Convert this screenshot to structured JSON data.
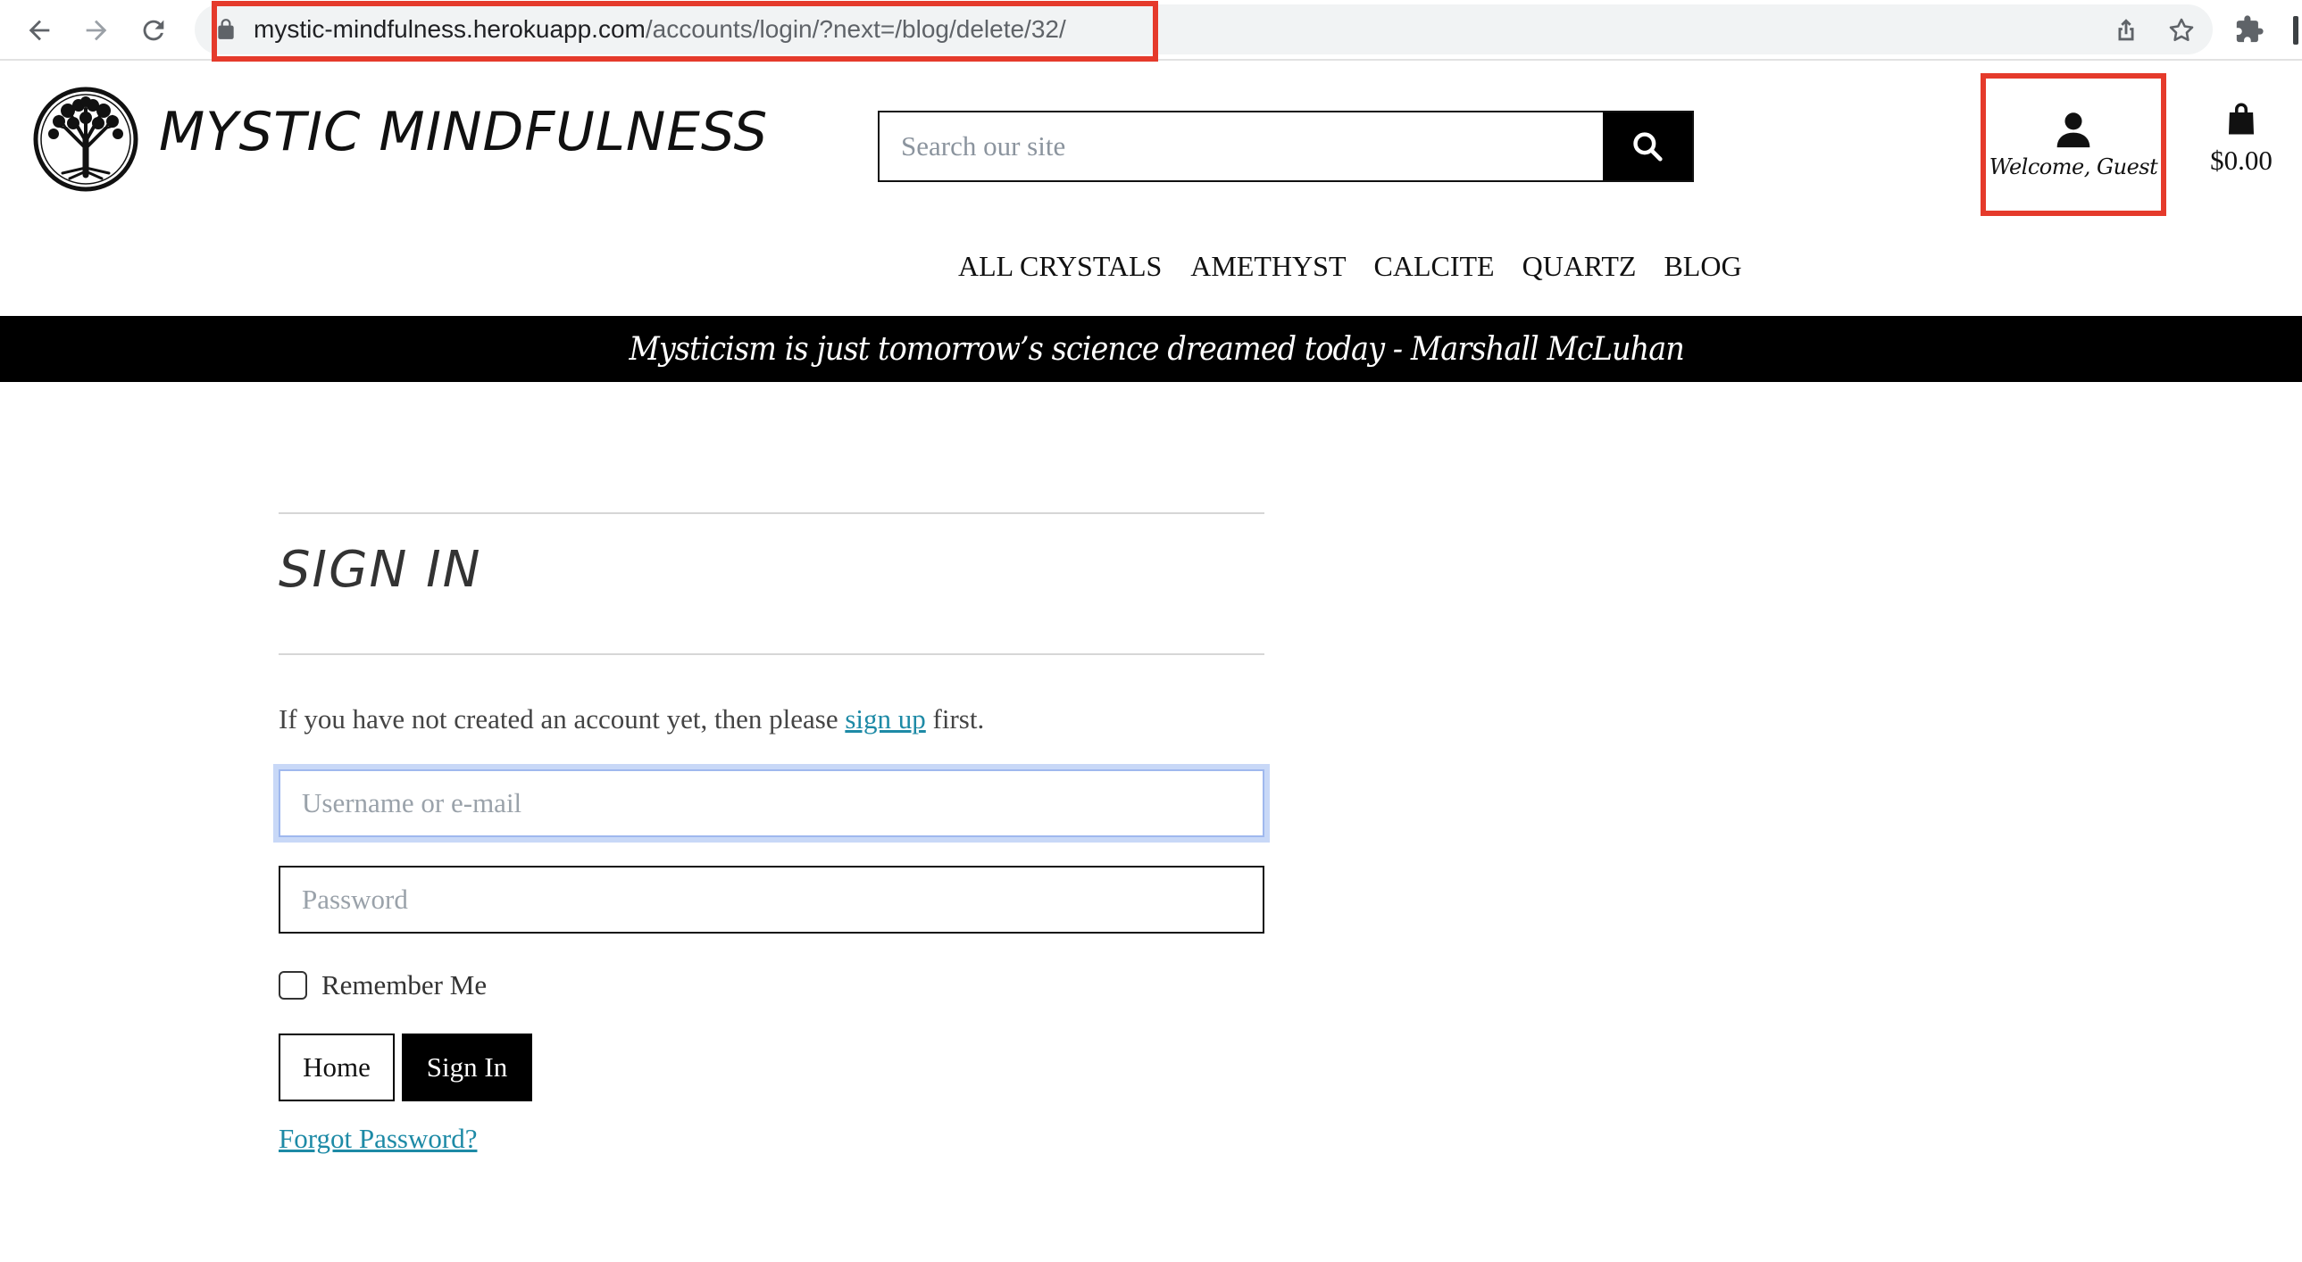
{
  "browser": {
    "url_host": "mystic-mindfulness.herokuapp.com",
    "url_path": "/accounts/login/?next=/blog/delete/32/"
  },
  "header": {
    "brand": "MYSTIC MINDFULNESS",
    "search_placeholder": "Search our site",
    "account_label": "Welcome, Guest",
    "cart_total": "$0.00"
  },
  "nav": {
    "items": [
      "ALL CRYSTALS",
      "AMETHYST",
      "CALCITE",
      "QUARTZ",
      "BLOG"
    ]
  },
  "quote": "Mysticism is just tomorrow’s science dreamed today - Marshall McLuhan",
  "signin": {
    "title": "SIGN IN",
    "intro_before": "If you have not created an account yet, then please ",
    "intro_link": "sign up",
    "intro_after": " first.",
    "username_placeholder": "Username or e-mail",
    "password_placeholder": "Password",
    "remember_label": "Remember Me",
    "home_button": "Home",
    "signin_button": "Sign In",
    "forgot_link": "Forgot Password?"
  },
  "colors": {
    "highlight": "#e53a2b",
    "link": "#1d8aa6",
    "focus_ring": "#c8d8f7"
  }
}
